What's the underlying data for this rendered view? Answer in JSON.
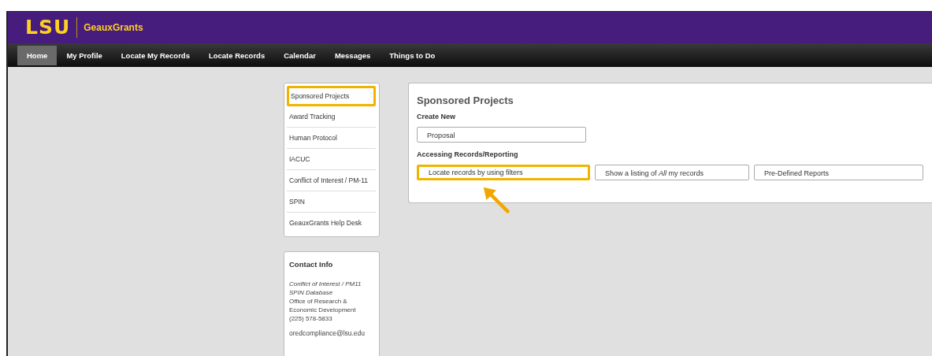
{
  "header": {
    "logo": "LSU",
    "app_name": "GeauxGrants"
  },
  "nav": [
    {
      "label": "Home",
      "selected": true
    },
    {
      "label": "My Profile",
      "selected": false
    },
    {
      "label": "Locate My Records",
      "selected": false
    },
    {
      "label": "Locate Records",
      "selected": false
    },
    {
      "label": "Calendar",
      "selected": false
    },
    {
      "label": "Messages",
      "selected": false
    },
    {
      "label": "Things to Do",
      "selected": false
    }
  ],
  "sidebar": {
    "items": [
      {
        "label": "Sponsored Projects",
        "highlighted": true
      },
      {
        "label": "Award Tracking",
        "highlighted": false
      },
      {
        "label": "Human Protocol",
        "highlighted": false
      },
      {
        "label": "IACUC",
        "highlighted": false
      },
      {
        "label": "Conflict of Interest / PM-11",
        "highlighted": false
      },
      {
        "label": "SPIN",
        "highlighted": false
      },
      {
        "label": "GeauxGrants Help Desk",
        "highlighted": false
      }
    ]
  },
  "contact": {
    "title": "Contact Info",
    "lines": [
      {
        "text": "Conflict of Interest / PM11",
        "italic": true
      },
      {
        "text": "SPIN Database",
        "italic": true
      },
      {
        "text": "Office of Research & Economic Development",
        "italic": false
      },
      {
        "text": "(225) 578-5833",
        "italic": false
      }
    ],
    "email": "oredcompliance@lsu.edu"
  },
  "panel": {
    "title": "Sponsored Projects",
    "sections": [
      {
        "heading": "Create New",
        "buttons": [
          {
            "label": "Proposal",
            "highlighted": false
          }
        ]
      },
      {
        "heading": "Accessing Records/Reporting",
        "buttons": [
          {
            "label": "Locate records by using filters",
            "highlighted": true
          },
          {
            "label": "Show a listing of *All* my records",
            "highlighted": false
          },
          {
            "label": "Pre-Defined Reports",
            "highlighted": false
          }
        ]
      }
    ]
  }
}
